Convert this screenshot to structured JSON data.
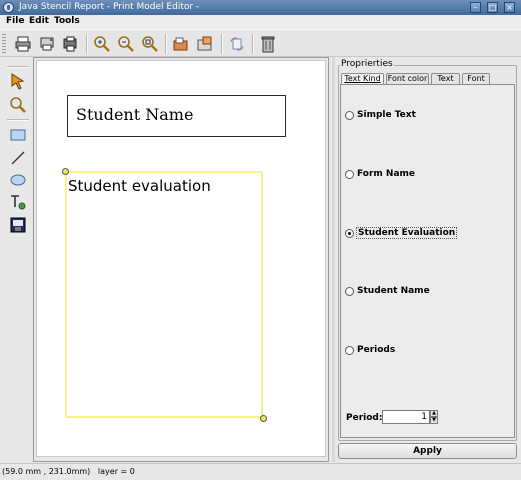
{
  "window": {
    "title": "Java Stencil Report - Print Model Editor -"
  },
  "menu": {
    "items": [
      "File",
      "Edit",
      "Tools"
    ]
  },
  "toolbar": {
    "icons": [
      "print-icon",
      "print-setup-icon",
      "print-preview-icon",
      "zoom-in-icon",
      "zoom-out-icon",
      "zoom-fit-icon",
      "open-icon",
      "save-icon",
      "refresh-icon",
      "trash-icon"
    ]
  },
  "tools": {
    "icons": [
      "pointer-icon",
      "zoom-icon",
      "rectangle-icon",
      "line-icon",
      "ellipse-icon",
      "text-icon",
      "image-icon"
    ]
  },
  "canvas": {
    "name_box_text": "Student Name",
    "eval_box_text": "Student evaluation"
  },
  "properties": {
    "title": "Proprierties",
    "tabs": [
      "Text Kind",
      "Font color",
      "Text",
      "Font"
    ],
    "active_tab": "Text Kind",
    "options": [
      "Simple Text",
      "Form Name",
      "Student Evaluation",
      "Student Name",
      "Periods"
    ],
    "selected_option": "Student Evaluation",
    "period_label": "Period:",
    "period_value": "1",
    "apply_label": "Apply"
  },
  "status": {
    "text": "(59.0 mm , 231.0mm)   layer = 0"
  },
  "colors": {
    "title_bar": "#4f77a8",
    "selection": "#f4f48a"
  }
}
